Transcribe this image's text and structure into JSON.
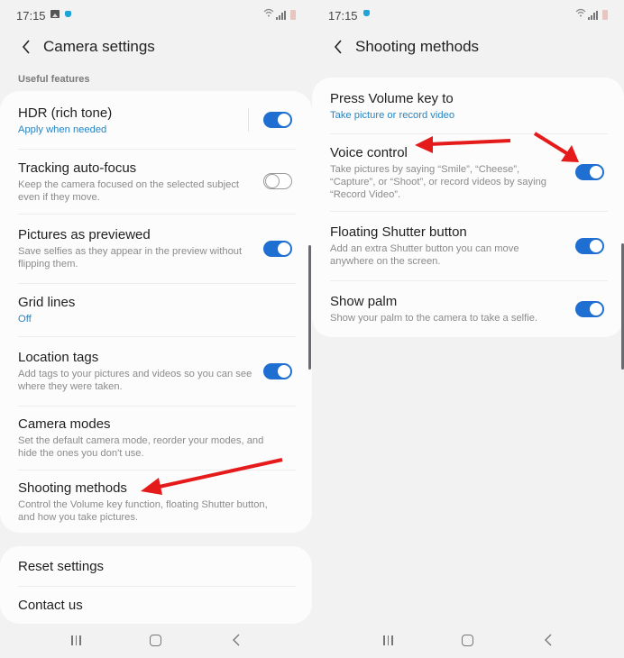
{
  "colors": {
    "accent": "#1e6fd1",
    "link": "#2a84c0",
    "annotation_arrow": "#e51b1b",
    "background": "#f2f2f2",
    "card": "#fcfcfc"
  },
  "left_screen": {
    "status_bar": {
      "time": "17:15",
      "left_icons": [
        "image-icon",
        "notification-dot-icon"
      ],
      "right_icons": [
        "wifi-icon",
        "signal-icon",
        "battery-icon"
      ]
    },
    "header": {
      "back_icon": "chevron-left-icon",
      "title": "Camera settings"
    },
    "section_label": "Useful features",
    "items": [
      {
        "title": "HDR (rich tone)",
        "subtitle": "Apply when needed",
        "subtitle_accent": true,
        "toggle": true,
        "toggle_on": true,
        "has_divider": true
      },
      {
        "title": "Tracking auto-focus",
        "subtitle": "Keep the camera focused on the selected subject even if they move.",
        "subtitle_accent": false,
        "toggle": true,
        "toggle_on": false
      },
      {
        "title": "Pictures as previewed",
        "subtitle": "Save selfies as they appear in the preview without flipping them.",
        "subtitle_accent": false,
        "toggle": true,
        "toggle_on": true
      },
      {
        "title": "Grid lines",
        "subtitle": "Off",
        "subtitle_accent": true,
        "toggle": false
      },
      {
        "title": "Location tags",
        "subtitle": "Add tags to your pictures and videos so you can see where they were taken.",
        "subtitle_accent": false,
        "toggle": true,
        "toggle_on": true
      },
      {
        "title": "Camera modes",
        "subtitle": "Set the default camera mode, reorder your modes, and hide the ones you don't use.",
        "subtitle_accent": false,
        "toggle": false
      },
      {
        "title": "Shooting methods",
        "subtitle": "Control the Volume key function, floating Shutter button, and how you take pictures.",
        "subtitle_accent": false,
        "toggle": false
      }
    ],
    "footer_items": [
      {
        "title": "Reset settings"
      },
      {
        "title": "Contact us"
      }
    ]
  },
  "right_screen": {
    "status_bar": {
      "time": "17:15",
      "left_icons": [
        "notification-dot-icon"
      ],
      "right_icons": [
        "wifi-icon",
        "signal-icon",
        "battery-icon"
      ]
    },
    "header": {
      "back_icon": "chevron-left-icon",
      "title": "Shooting methods"
    },
    "items": [
      {
        "title": "Press Volume key to",
        "subtitle": "Take picture or record video",
        "subtitle_accent": true,
        "toggle": false
      },
      {
        "title": "Voice control",
        "subtitle": "Take pictures by saying “Smile”, “Cheese”, “Capture”, or “Shoot”, or record videos by saying “Record Video”.",
        "subtitle_accent": false,
        "toggle": true,
        "toggle_on": true
      },
      {
        "title": "Floating Shutter button",
        "subtitle": "Add an extra Shutter button you can move anywhere on the screen.",
        "subtitle_accent": false,
        "toggle": true,
        "toggle_on": true
      },
      {
        "title": "Show palm",
        "subtitle": "Show your palm to the camera to take a selfie.",
        "subtitle_accent": false,
        "toggle": true,
        "toggle_on": true
      }
    ]
  },
  "navigation_bar": {
    "buttons": [
      "recents-icon",
      "home-icon",
      "back-icon"
    ]
  },
  "annotations": [
    {
      "type": "arrow",
      "screen": "left",
      "points_to": "Shooting methods"
    },
    {
      "type": "arrow",
      "screen": "right",
      "points_to": "Voice control"
    },
    {
      "type": "arrow",
      "screen": "right",
      "points_to": "Voice control toggle"
    }
  ]
}
